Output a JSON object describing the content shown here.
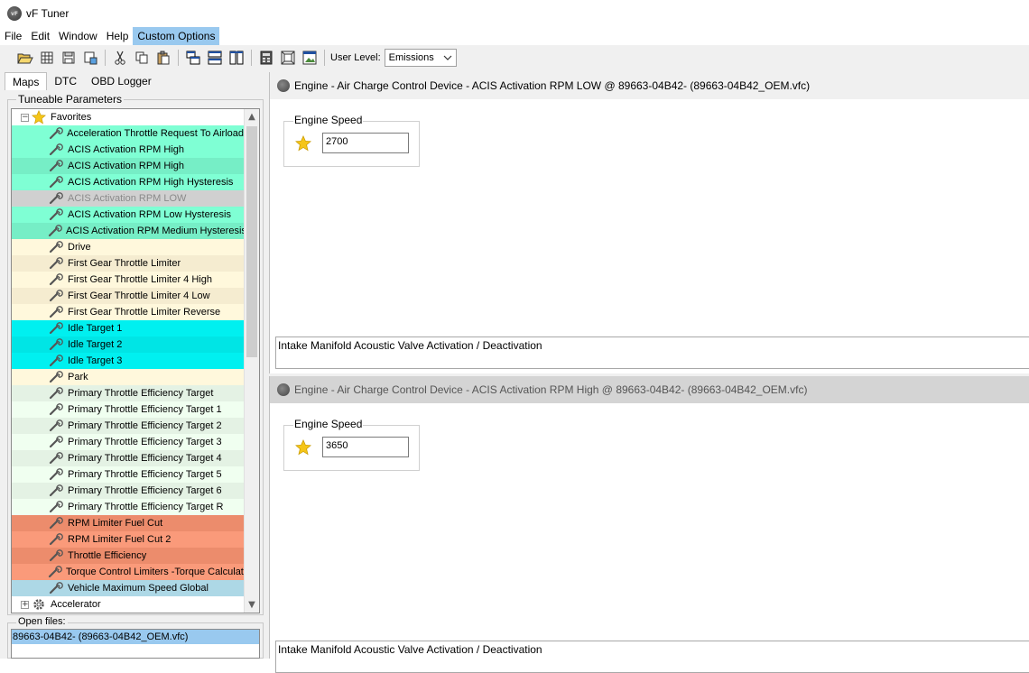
{
  "window": {
    "title": "vF Tuner",
    "logo_text": "vF"
  },
  "menu": [
    "File",
    "Edit",
    "Window",
    "Help",
    "Custom Options"
  ],
  "toolbar": {
    "user_level_label": "User Level:",
    "user_level_value": "Emissions",
    "icons": [
      "open-folder-icon",
      "grid-icon",
      "save-icon",
      "save-as-icon",
      "cut-icon",
      "copy-icon",
      "paste-icon",
      "cascade-windows-icon",
      "tile-horizontal-icon",
      "tile-vertical-icon",
      "calculator-icon",
      "fit-screen-icon",
      "image-window-icon"
    ]
  },
  "left_tabs": [
    {
      "label": "Maps",
      "active": true
    },
    {
      "label": "DTC",
      "active": false
    },
    {
      "label": "OBD Logger",
      "active": false
    }
  ],
  "tree": {
    "group_label": "Tuneable Parameters",
    "rows": [
      {
        "type": "folder",
        "label": "Favorites",
        "icon": "star-icon",
        "expander": "−",
        "bg": "#ffffff"
      },
      {
        "type": "param",
        "label": "Acceleration Throttle Request To Airload",
        "bg": "#7fffd4"
      },
      {
        "type": "param",
        "label": "ACIS Activation RPM High",
        "bg": "#7fffd4"
      },
      {
        "type": "param",
        "label": "ACIS Activation RPM High",
        "bg": "#76eec6"
      },
      {
        "type": "param",
        "label": "ACIS Activation RPM High Hysteresis",
        "bg": "#7fffd4"
      },
      {
        "type": "param",
        "label": "ACIS Activation RPM LOW",
        "bg": "#d0d0d0",
        "color": "#8a8a8a"
      },
      {
        "type": "param",
        "label": "ACIS Activation RPM Low Hysteresis",
        "bg": "#7fffd4"
      },
      {
        "type": "param",
        "label": "ACIS Activation RPM Medium Hysteresis",
        "bg": "#76eec6"
      },
      {
        "type": "param",
        "label": "Drive",
        "bg": "#fff8dc"
      },
      {
        "type": "param",
        "label": "First Gear Throttle Limiter",
        "bg": "#f5ecd0"
      },
      {
        "type": "param",
        "label": "First Gear Throttle Limiter 4 High",
        "bg": "#fff8dc"
      },
      {
        "type": "param",
        "label": "First Gear Throttle Limiter 4 Low",
        "bg": "#f5ecd0"
      },
      {
        "type": "param",
        "label": "First Gear Throttle Limiter Reverse",
        "bg": "#fff8dc"
      },
      {
        "type": "param",
        "label": "Idle Target 1",
        "bg": "#00f0f0"
      },
      {
        "type": "param",
        "label": "Idle Target 2",
        "bg": "#00e5e5"
      },
      {
        "type": "param",
        "label": "Idle Target 3",
        "bg": "#00f0f0"
      },
      {
        "type": "param",
        "label": "Park",
        "bg": "#fff8dc"
      },
      {
        "type": "param",
        "label": "Primary Throttle Efficiency Target",
        "bg": "#e4f2e4"
      },
      {
        "type": "param",
        "label": "Primary Throttle Efficiency Target 1",
        "bg": "#f0fff0"
      },
      {
        "type": "param",
        "label": "Primary Throttle Efficiency Target 2",
        "bg": "#e4f2e4"
      },
      {
        "type": "param",
        "label": "Primary Throttle Efficiency Target 3",
        "bg": "#f0fff0"
      },
      {
        "type": "param",
        "label": "Primary Throttle Efficiency Target 4",
        "bg": "#e4f2e4"
      },
      {
        "type": "param",
        "label": "Primary Throttle Efficiency Target 5",
        "bg": "#f0fff0"
      },
      {
        "type": "param",
        "label": "Primary Throttle Efficiency Target 6",
        "bg": "#e4f2e4"
      },
      {
        "type": "param",
        "label": "Primary Throttle Efficiency Target R",
        "bg": "#f0fff0"
      },
      {
        "type": "param",
        "label": "RPM Limiter Fuel Cut",
        "bg": "#ec8c6c"
      },
      {
        "type": "param",
        "label": "RPM Limiter Fuel Cut 2",
        "bg": "#fa9a7a"
      },
      {
        "type": "param",
        "label": "Throttle Efficiency",
        "bg": "#ec8c6c"
      },
      {
        "type": "param",
        "label": "Torque Control Limiters -Torque Calculation",
        "bg": "#fa9a7a"
      },
      {
        "type": "param",
        "label": "Vehicle Maximum Speed Global",
        "bg": "#add8e6"
      },
      {
        "type": "folder",
        "label": "Accelerator",
        "icon": "gear-icon",
        "expander": "+",
        "bg": "#ffffff"
      }
    ]
  },
  "open_files": {
    "label": "Open files:",
    "items": [
      "89663-04B42- (89663-04B42_OEM.vfc)"
    ]
  },
  "panels": [
    {
      "title": "Engine - Air Charge Control Device - ACIS Activation RPM LOW @ 89663-04B42- (89663-04B42_OEM.vfc)",
      "field_label": "Engine Speed",
      "value": "2700",
      "description": "Intake Manifold Acoustic Valve Activation / Deactivation"
    },
    {
      "title": "Engine - Air Charge Control Device - ACIS Activation RPM High @ 89663-04B42- (89663-04B42_OEM.vfc)",
      "field_label": "Engine Speed",
      "value": "3650",
      "description": "Intake Manifold Acoustic Valve Activation / Deactivation"
    }
  ]
}
